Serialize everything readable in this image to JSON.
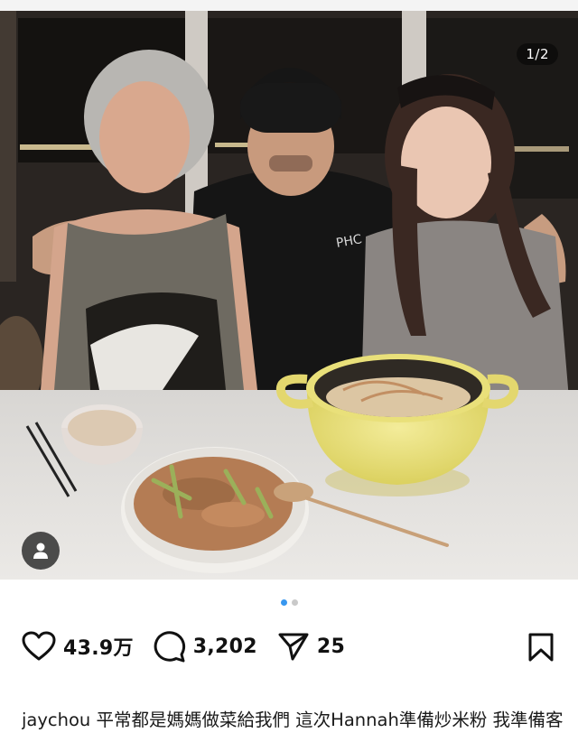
{
  "post": {
    "page_counter": "1/2",
    "photo_icon": "photo-icon",
    "tag_icon": "person-tag-icon",
    "carousel": {
      "total": 2,
      "active_index": 0
    }
  },
  "actions": {
    "likes": {
      "icon": "heart-icon",
      "count": "43.9万"
    },
    "comments": {
      "icon": "comment-icon",
      "count": "3,202"
    },
    "shares": {
      "icon": "send-icon",
      "count": "25"
    },
    "save": {
      "icon": "bookmark-icon"
    }
  },
  "caption": {
    "username": "jaychou",
    "text": " 平常都是媽媽做菜給我們 這次Hannah準備炒米粉 我準備客家小炒 合作母親節大餐給媽媽"
  },
  "colors": {
    "accent_dot": "#3797ef",
    "inactive_dot": "#c9c9c9"
  }
}
